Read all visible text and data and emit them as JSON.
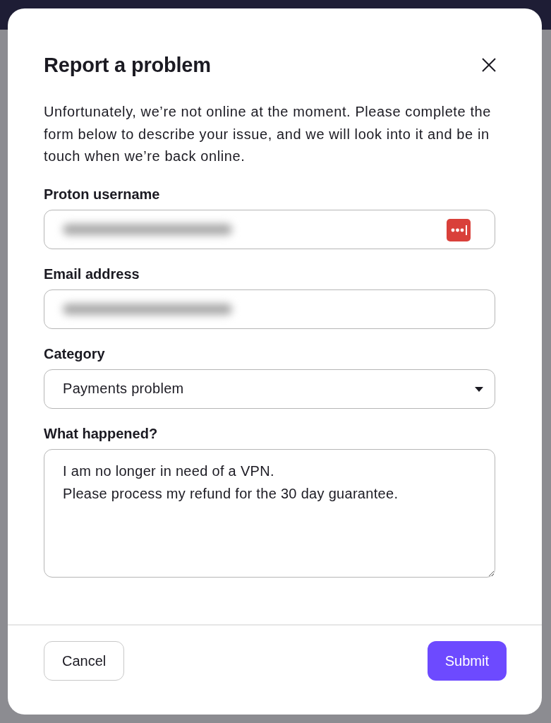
{
  "dialog": {
    "title": "Report a problem",
    "intro": "Unfortunately, we’re not online at the moment. Please complete the form below to describe your issue, and we will look into it and be in touch when we’re back online.",
    "fields": [
      {
        "kind": "input",
        "label": "Proton username",
        "value_blurred": true,
        "password_manager_icon": true
      },
      {
        "kind": "input",
        "label": "Email address",
        "value_blurred": true,
        "password_manager_icon": false
      },
      {
        "kind": "select",
        "label": "Category",
        "value": "Payments problem"
      },
      {
        "kind": "textarea",
        "label": "What happened?",
        "value": "I am no longer in need of a VPN.\nPlease process my refund for the 30 day guarantee."
      }
    ],
    "buttons": [
      {
        "kind": "secondary",
        "label": "Cancel"
      },
      {
        "kind": "primary",
        "label": "Submit"
      }
    ]
  }
}
